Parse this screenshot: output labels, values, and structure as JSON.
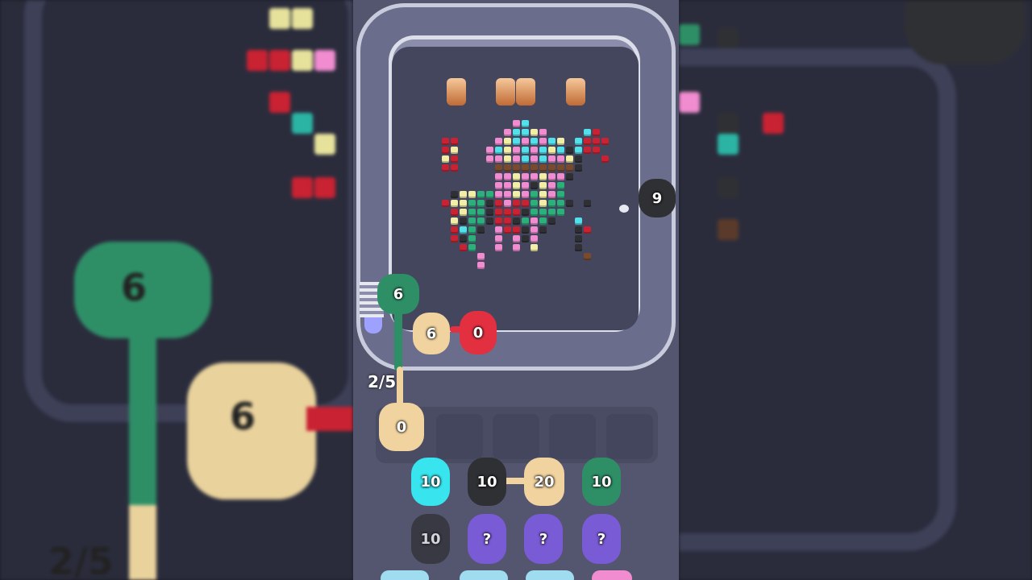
{
  "game": {
    "counter": "2/5",
    "side_count": "9",
    "pullers": [
      {
        "label": "6",
        "color": "#2e8f67"
      },
      {
        "label": "6",
        "color": "#f1d39f"
      },
      {
        "label": "0",
        "color": "#e23040"
      },
      {
        "label": "0",
        "color": "#f1d39f"
      }
    ],
    "queue_row1": [
      {
        "label": "10",
        "color": "#38e4ee"
      },
      {
        "label": "10",
        "color": "#2f3034"
      },
      {
        "label": "20",
        "color": "#f1d39f"
      },
      {
        "label": "10",
        "color": "#2e8f67"
      }
    ],
    "queue_row2": [
      {
        "label": "10",
        "color": "#2f3034"
      },
      {
        "label": "?",
        "color": "#7a5bd6"
      },
      {
        "label": "?",
        "color": "#7a5bd6"
      },
      {
        "label": "?",
        "color": "#7a5bd6"
      }
    ],
    "empty_slots": 4,
    "side_labels": {
      "big_green": "6",
      "big_yellow": "6",
      "big_counter": "2/5"
    }
  }
}
